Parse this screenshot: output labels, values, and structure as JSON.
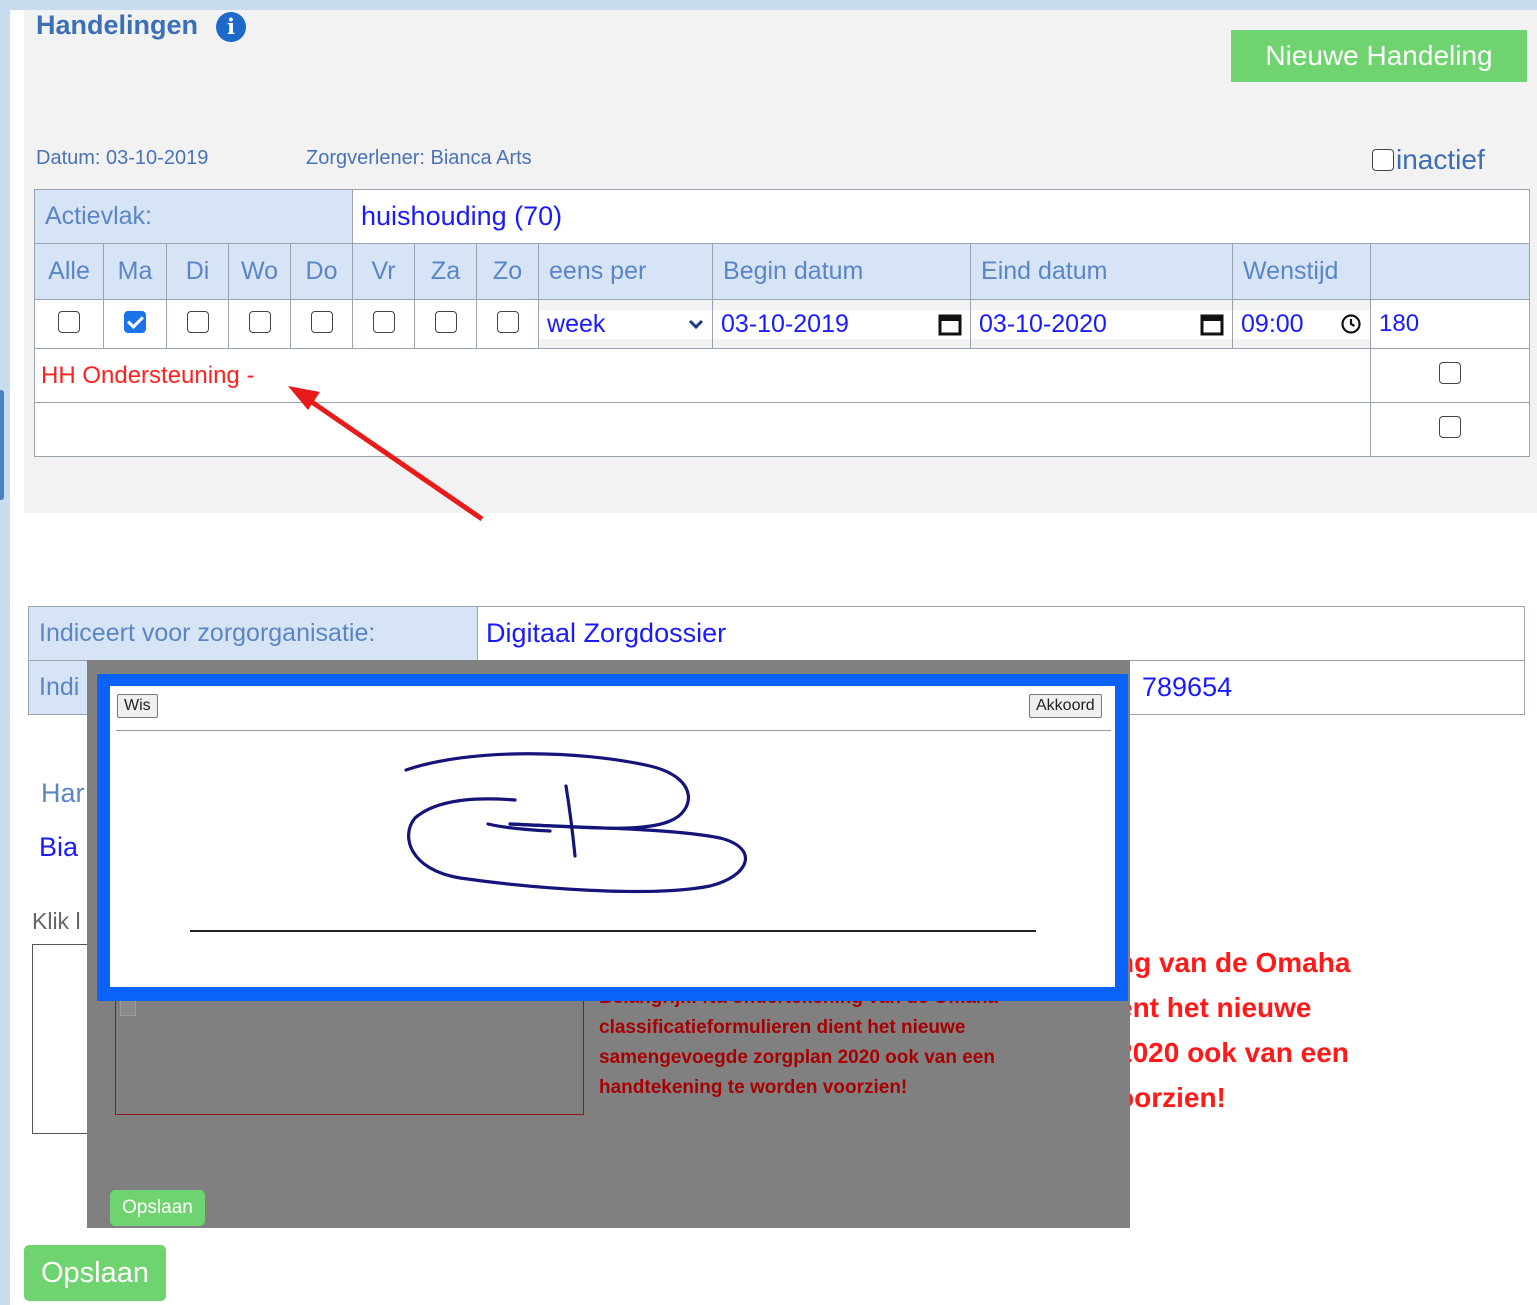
{
  "section": {
    "title": "Handelingen",
    "new_button": "Nieuwe Handeling",
    "info_glyph": "i"
  },
  "meta": {
    "datum": "Datum: 03-10-2019",
    "zorgverlener": "Zorgverlener: Bianca Arts",
    "inactief_label": "inactief"
  },
  "actievlak": {
    "label": "Actievlak:",
    "value": "huishouding (70)"
  },
  "columns": [
    "Alle",
    "Ma",
    "Di",
    "Wo",
    "Do",
    "Vr",
    "Za",
    "Zo",
    "eens per",
    "Begin datum",
    "Eind datum",
    "Wenstijd"
  ],
  "schedule": {
    "days_checked": [
      false,
      true,
      false,
      false,
      false,
      false,
      false,
      false
    ],
    "eens_per": "week",
    "begin_datum": "03-10-2019",
    "eind_datum": "03-10-2020",
    "wenstijd": "09:00",
    "minutes": "180"
  },
  "handeling_text": "HH Ondersteuning -",
  "zorg": {
    "label": "Indiceert voor zorgorganisatie:",
    "value": "Digitaal Zorgdossier",
    "row2_label": "Indi",
    "row2_value": "789654"
  },
  "partials": {
    "han": "Har",
    "bia": "Bia",
    "klik": "Klik l"
  },
  "notice_lines": [
    "ng van de Omaha",
    "ent het nieuwe",
    "2020 ook van een",
    "oorzien!"
  ],
  "modal": {
    "notice_top": "Belangrijk: Na ondertekening van de Omaha",
    "notice_lines": [
      "classificatieformulieren dient het nieuwe",
      "samengevoegde zorgplan 2020 ook van een",
      "handtekening te worden voorzien!"
    ],
    "opslaan": "Opslaan"
  },
  "signature": {
    "clear_button": "Wis",
    "accept_button": "Akkoord",
    "ink_color": "#14147a"
  },
  "footer": {
    "save_button": "Opslaan"
  },
  "colors": {
    "accent": "#3b6fb6",
    "green": "#6fd36f",
    "blue_frame": "#0b62fb",
    "red_text": "#ff2020"
  }
}
